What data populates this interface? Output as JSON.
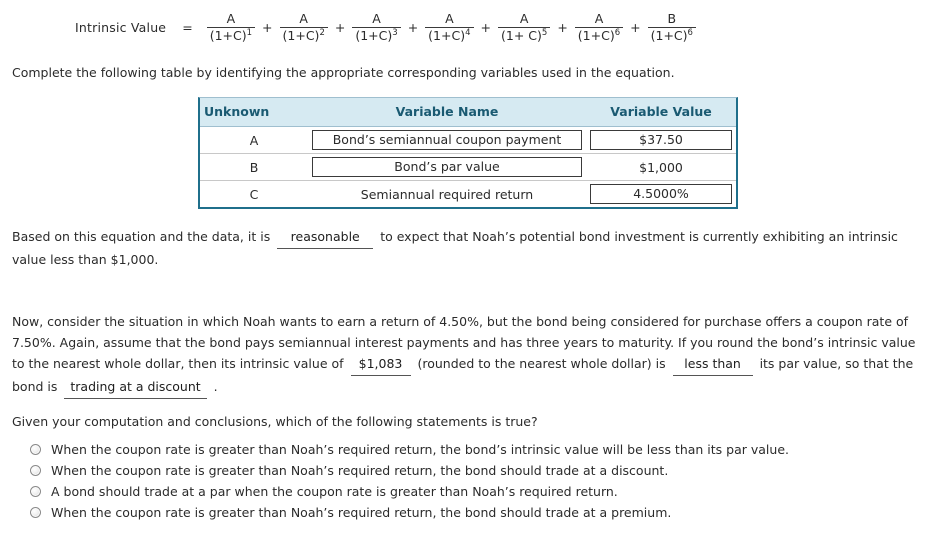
{
  "equation": {
    "label": "Intrinsic Value",
    "equals": "=",
    "plus": "+",
    "terms": [
      {
        "numerator": "A",
        "denominator": "(1+C)",
        "exponent": "1"
      },
      {
        "numerator": "A",
        "denominator": "(1+C)",
        "exponent": "2"
      },
      {
        "numerator": "A",
        "denominator": "(1+C)",
        "exponent": "3"
      },
      {
        "numerator": "A",
        "denominator": "(1+C)",
        "exponent": "4"
      },
      {
        "numerator": "A",
        "denominator": "(1+ C)",
        "exponent": "5"
      },
      {
        "numerator": "A",
        "denominator": "(1+C)",
        "exponent": "6"
      },
      {
        "numerator": "B",
        "denominator": "(1+C)",
        "exponent": "6"
      }
    ]
  },
  "instruction": "Complete the following table by identifying the appropriate corresponding variables used in the equation.",
  "table": {
    "headers": [
      "Unknown",
      "Variable Name",
      "Variable Value"
    ],
    "rows": [
      {
        "unknown": "A",
        "name": "Bond’s semiannual coupon payment",
        "name_boxed": true,
        "value": "$37.50",
        "value_boxed": true
      },
      {
        "unknown": "B",
        "name": "Bond’s par value",
        "name_boxed": true,
        "value": "$1,000",
        "value_boxed": false
      },
      {
        "unknown": "C",
        "name": "Semiannual required return",
        "name_boxed": false,
        "value": "4.5000%",
        "value_boxed": true
      }
    ]
  },
  "paragraph_based": {
    "part1": "Based on this equation and the data, it is",
    "blank1": "reasonable",
    "part2": "to expect that Noah’s potential bond investment is currently exhibiting an intrinsic value less than $1,000."
  },
  "paragraph_now": {
    "part1": "Now, consider the situation in which Noah wants to earn a return of 4.50%, but the bond being considered for purchase offers a coupon rate of 7.50%. Again, assume that the bond pays semiannual interest payments and has three years to maturity. If you round the bond’s intrinsic value to the nearest whole dollar, then its intrinsic value of",
    "blank_value": "$1,083",
    "part2": "(rounded to the nearest whole dollar) is",
    "blank_comparison": "less than",
    "part3": "its par value, so that the bond is",
    "blank_trading": "trading at a discount",
    "part4": "."
  },
  "question": "Given your computation and conclusions, which of the following statements is true?",
  "options": [
    "When the coupon rate is greater than Noah’s required return, the bond’s intrinsic value will be less than its par value.",
    "When the coupon rate is greater than Noah’s required return, the bond should trade at a discount.",
    "A bond should trade at a par when the coupon rate is greater than Noah’s required return.",
    "When the coupon rate is greater than Noah’s required return, the bond should trade at a premium."
  ],
  "colors": {
    "table_border": "#1f6f8b",
    "table_header_bg": "#d6eaf2",
    "table_header_text": "#1a5a72",
    "body_text": "#2b2b2b"
  }
}
